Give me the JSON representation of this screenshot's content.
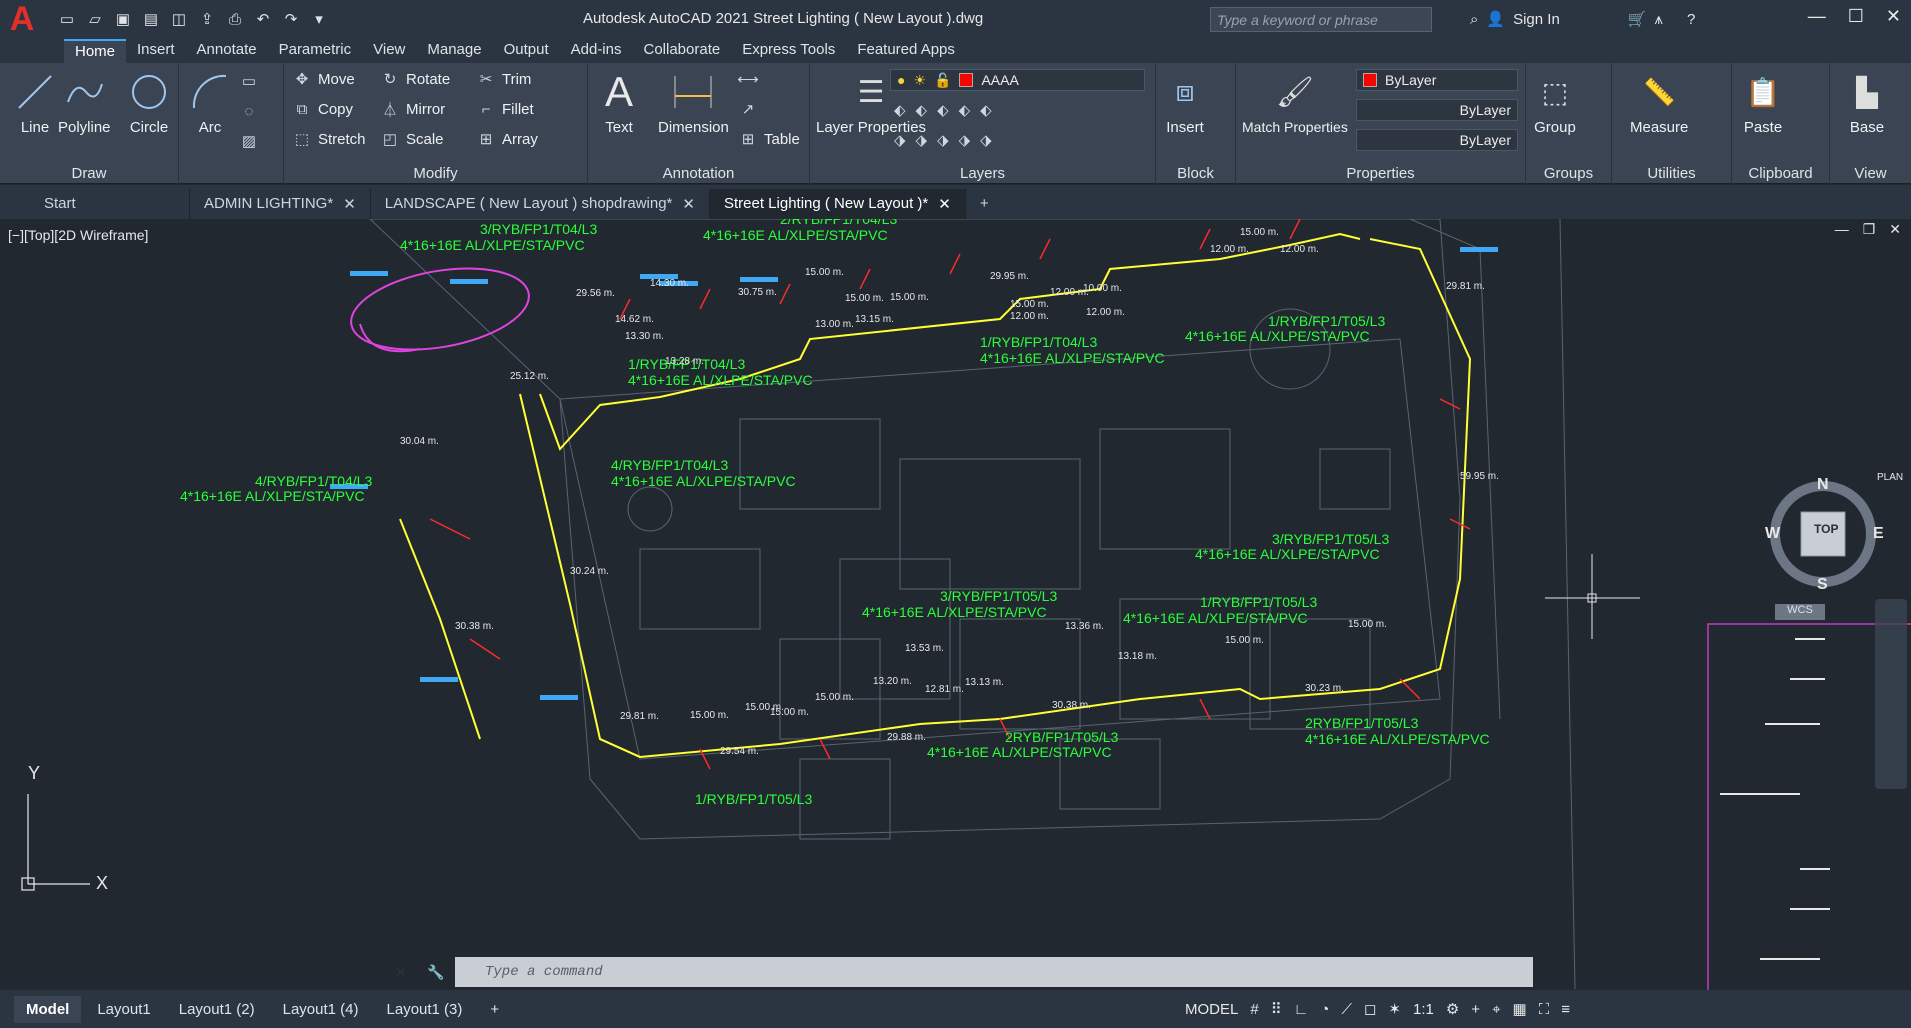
{
  "app": {
    "title": "Autodesk AutoCAD 2021    Street Lighting ( New Layout ).dwg",
    "search_placeholder": "Type a keyword or phrase",
    "sign_in": "Sign In"
  },
  "ribbon_tabs": [
    "Home",
    "Insert",
    "Annotate",
    "Parametric",
    "View",
    "Manage",
    "Output",
    "Add-ins",
    "Collaborate",
    "Express Tools",
    "Featured Apps"
  ],
  "draw": {
    "title": "Draw",
    "line": "Line",
    "polyline": "Polyline",
    "circle": "Circle",
    "arc": "Arc"
  },
  "modify": {
    "title": "Modify",
    "move": "Move",
    "rotate": "Rotate",
    "trim": "Trim",
    "copy": "Copy",
    "mirror": "Mirror",
    "fillet": "Fillet",
    "stretch": "Stretch",
    "scale": "Scale",
    "array": "Array"
  },
  "annotation": {
    "title": "Annotation",
    "text": "Text",
    "dimension": "Dimension",
    "table": "Table"
  },
  "layers": {
    "title": "Layers",
    "layer_properties": "Layer Properties",
    "current_layer": "AAAA"
  },
  "block": {
    "title": "Block",
    "insert": "Insert"
  },
  "properties": {
    "title": "Properties",
    "match": "Match Properties",
    "color": "ByLayer",
    "linetype": "ByLayer",
    "lineweight": "ByLayer"
  },
  "groups": {
    "title": "Groups",
    "group": "Group"
  },
  "utilities": {
    "title": "Utilities",
    "measure": "Measure"
  },
  "clipboard": {
    "title": "Clipboard",
    "paste": "Paste"
  },
  "view_panel": {
    "title": "View",
    "base": "Base"
  },
  "doc_tabs": [
    {
      "label": "Start"
    },
    {
      "label": "ADMIN LIGHTING*"
    },
    {
      "label": "LANDSCAPE ( New Layout ) shopdrawing*"
    },
    {
      "label": "Street Lighting ( New Layout )*"
    }
  ],
  "viewport_label": "[−][Top][2D Wireframe]",
  "viewcube": {
    "n": "N",
    "s": "S",
    "e": "E",
    "w": "W",
    "top": "TOP",
    "wcs": "WCS",
    "plan": "PLAN"
  },
  "drawing": {
    "cable_spec": "4*16+16E AL/XLPE/STA/PVC",
    "circuits": [
      "3/RYB/FP1/T04/L3",
      "2/RYB/FP1/T04/L3",
      "1/RYB/FP1/T04/L3",
      "1/RYB/FP1/T04/L3",
      "4/RYB/FP1/T04/L3",
      "4/RYB/FP1/T04/L3",
      "1/RYB/FP1/T05/L3",
      "3/RYB/FP1/T05/L3",
      "3/RYB/FP1/T05/L3",
      "1/RYB/FP1/T05/L3",
      "2RYB/FP1/T05/L3",
      "2RYB/FP1/T05/L3",
      "1/RYB/FP1/T05/L3"
    ],
    "dims": [
      "29.95 m.",
      "15.00 m.",
      "10.00 m.",
      "15.00 m.",
      "30.75 m.",
      "15.00 m.",
      "12.00 m.",
      "12.00 m.",
      "15.00 m.",
      "15.00 m.",
      "12.00 m.",
      "12.00 m.",
      "12.00 m.",
      "29.56 m.",
      "14.30 m.",
      "14.62 m.",
      "13.00 m.",
      "13.15 m.",
      "13.30 m.",
      "13.28 m.",
      "25.12 m.",
      "30.04 m.",
      "30.24 m.",
      "30.38 m.",
      "29.81 m.",
      "59.95 m.",
      "13.53 m.",
      "13.36 m.",
      "13.18 m.",
      "13.20 m.",
      "12.81 m.",
      "13.13 m.",
      "15.00 m.",
      "15.00 m.",
      "15.00 m.",
      "15.00 m.",
      "15.00 m.",
      "30.38 m.",
      "30.23 m.",
      "29.88 m.",
      "29.54 m.",
      "29.81 m.",
      "15.00 m."
    ]
  },
  "command_placeholder": "Type a command",
  "layout_tabs": [
    "Model",
    "Layout1",
    "Layout1 (2)",
    "Layout1 (4)",
    "Layout1 (3)"
  ],
  "status": {
    "model": "MODEL",
    "scale": "1:1"
  },
  "accent": "#3fa9f5",
  "cad_green": "#2bff3a",
  "cad_yellow": "#ffff33"
}
